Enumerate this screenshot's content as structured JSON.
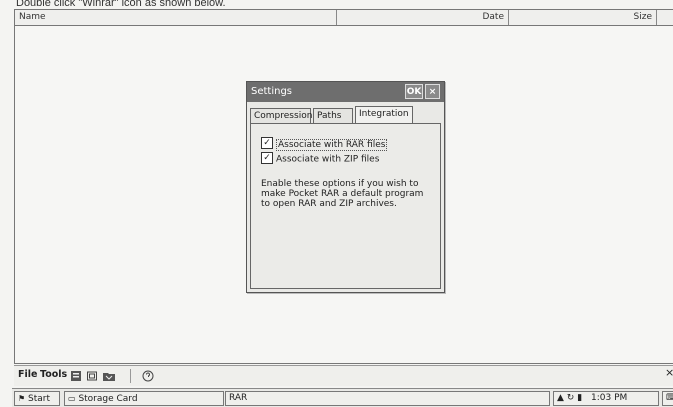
{
  "instruction": "Double click \"Winrar\" icon as shown below.",
  "file_list": {
    "columns": {
      "name": "Name",
      "date": "Date",
      "size": "Size"
    }
  },
  "dialog": {
    "title": "Settings",
    "ok_label": "OK",
    "close_label": "×",
    "tabs": [
      "Compression",
      "Paths",
      "Integration"
    ],
    "active_tab": "Integration",
    "options": [
      {
        "label": "Associate with RAR files",
        "checked": true
      },
      {
        "label": "Associate with ZIP files",
        "checked": true
      }
    ],
    "check_mark": "✓",
    "description": "Enable these options if you wish to make Pocket RAR a default program to open RAR and ZIP archives."
  },
  "command_bar": {
    "menus": [
      "File",
      "Tools"
    ],
    "icons": [
      "archive-icon",
      "folder-icon",
      "extract-icon",
      "help-icon"
    ],
    "close_label": "×"
  },
  "taskbar": {
    "start_label": "Start",
    "storage_label": "Storage Card",
    "app_label": "RAR",
    "time": "1:03 PM",
    "tray_icons": [
      "network-icon",
      "sync-icon",
      "battery-icon",
      "keyboard-icon"
    ]
  }
}
